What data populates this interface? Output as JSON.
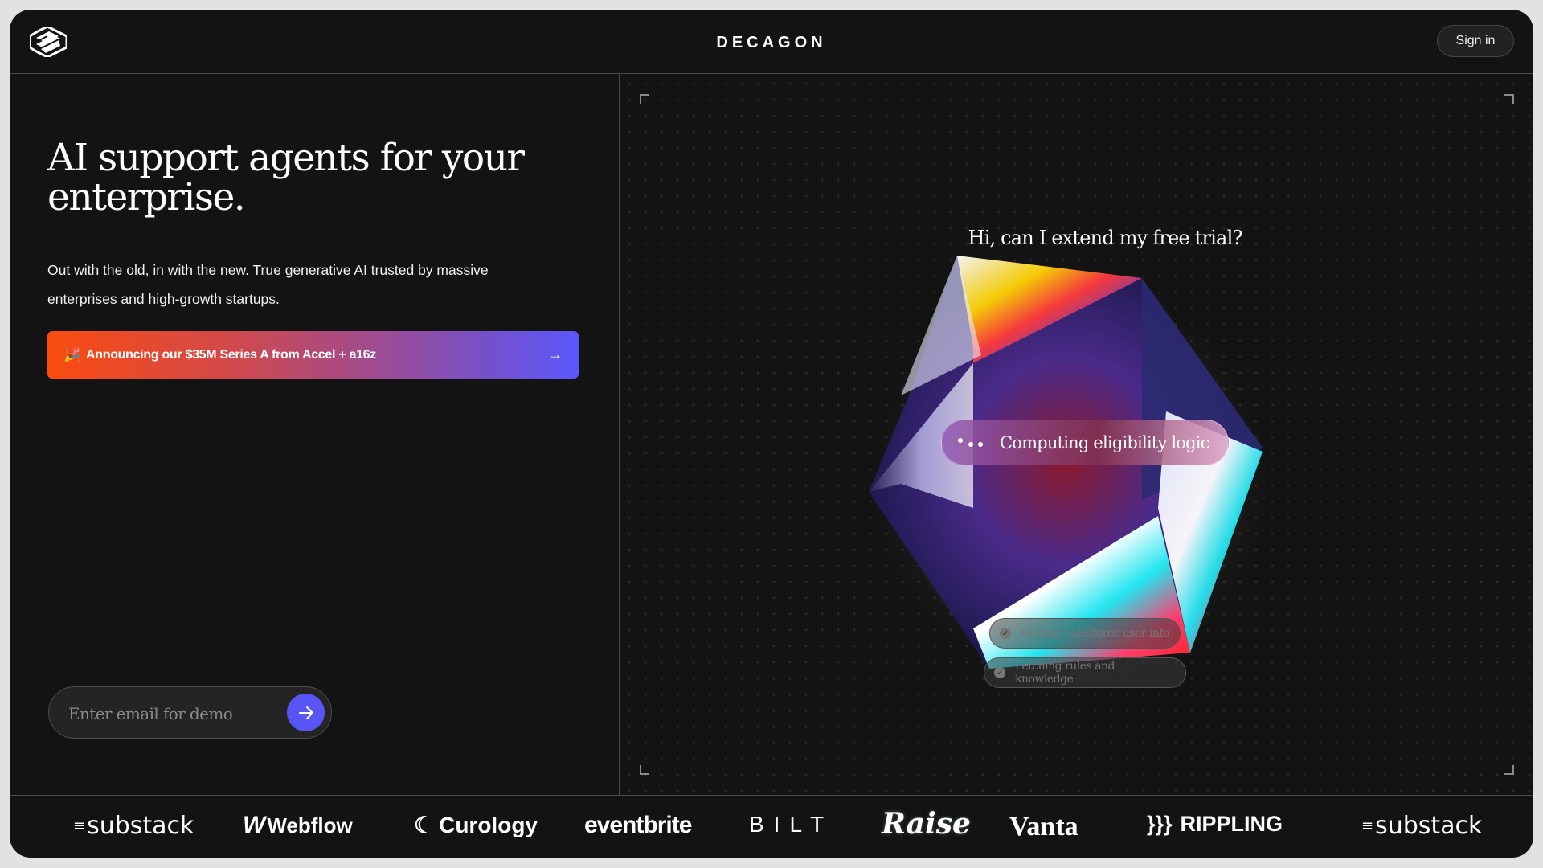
{
  "header": {
    "brand": "DECAGON",
    "logo_icon": "decagon-logo-icon",
    "signin_label": "Sign in"
  },
  "hero": {
    "headline": "AI support agents for your enterprise.",
    "subtext": "Out with the old, in with the new. True generative AI trusted by massive enterprises and high-growth startups.",
    "announcement": {
      "icon": "party-popper-icon",
      "emoji": "🎉",
      "label": "Announcing our $35M Series A from Accel + a16z",
      "arrow": "→"
    },
    "email": {
      "placeholder": "Enter email for demo",
      "value": ""
    }
  },
  "demo": {
    "question": "Hi, can I extend my free trial?",
    "status": "Computing eligibility logic",
    "steps": [
      "Getting Salesforce user info",
      "Fetching rules and knowledge"
    ]
  },
  "logos": [
    "substack",
    "Webflow",
    "Curology",
    "eventbrite",
    "BILT",
    "Raise",
    "Vanta",
    "RIPPLING",
    "substack"
  ],
  "colors": {
    "accent": "#5756f5",
    "gradient_start": "#fb4b0f",
    "gradient_end": "#5a57fb",
    "background": "#131313"
  }
}
